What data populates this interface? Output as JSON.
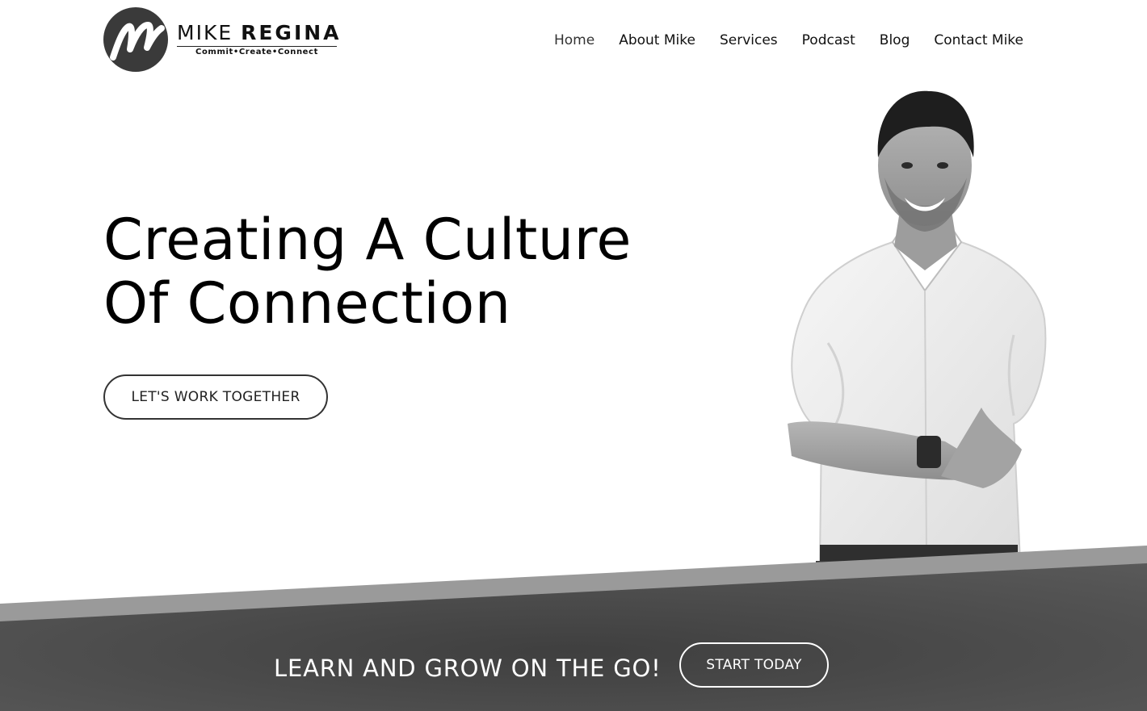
{
  "brand": {
    "first_name": "MIKE",
    "last_name": "REGINA",
    "tagline": "Commit•Create•Connect"
  },
  "nav": {
    "items": [
      {
        "label": "Home",
        "active": true
      },
      {
        "label": "About Mike"
      },
      {
        "label": "Services"
      },
      {
        "label": "Podcast"
      },
      {
        "label": "Blog"
      },
      {
        "label": "Contact Mike"
      }
    ]
  },
  "hero": {
    "title_line1": "Creating A Culture",
    "title_line2": "Of Connection",
    "cta_label": "LET'S WORK TOGETHER"
  },
  "banner": {
    "text": "LEARN AND GROW ON THE GO!",
    "cta_label": "START TODAY"
  },
  "colors": {
    "logo_circle": "#3a3a3a",
    "banner_dark": "#4a4a4a",
    "banner_stripe": "#9a9a9a",
    "text": "#111111"
  }
}
